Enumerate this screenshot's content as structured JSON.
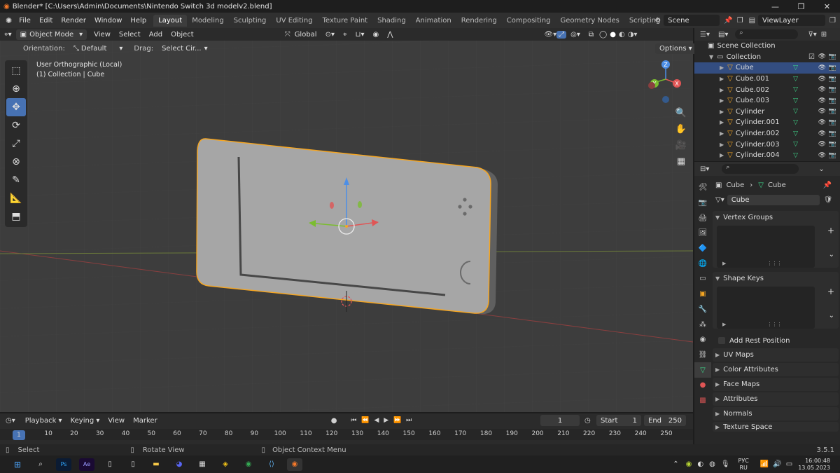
{
  "window": {
    "title": "Blender* [C:\\Users\\Admin\\Documents\\Nintendo Switch 3d modelv2.blend]",
    "controls": [
      "—",
      "❐",
      "✕"
    ]
  },
  "menu": [
    "File",
    "Edit",
    "Render",
    "Window",
    "Help"
  ],
  "workspace_tabs": [
    "Layout",
    "Modeling",
    "Sculpting",
    "UV Editing",
    "Texture Paint",
    "Shading",
    "Animation",
    "Rendering",
    "Compositing",
    "Geometry Nodes",
    "Scripting"
  ],
  "active_workspace": "Layout",
  "scene": {
    "name": "Scene",
    "view_layer": "ViewLayer"
  },
  "viewport_header": {
    "mode": "Object Mode",
    "menus": [
      "View",
      "Select",
      "Add",
      "Object"
    ],
    "transform_orientation": "Global",
    "orientation_label": "Orientation:",
    "orientation_value": "Default",
    "drag_label": "Drag:",
    "drag_value": "Select Cir...",
    "options": "Options"
  },
  "viewport_info": {
    "line1": "User Orthographic (Local)",
    "line2": "(1) Collection | Cube"
  },
  "gizmo": {
    "x": "X",
    "y": "Y",
    "z": "Z"
  },
  "tools": [
    "select-box",
    "cursor",
    "move",
    "rotate",
    "scale",
    "transform",
    "annotate",
    "measure",
    "add-cube"
  ],
  "active_tool": "move",
  "outliner": {
    "scene_collection": "Scene Collection",
    "collection": "Collection",
    "objects": [
      "Cube",
      "Cube.001",
      "Cube.002",
      "Cube.003",
      "Cylinder",
      "Cylinder.001",
      "Cylinder.002",
      "Cylinder.003",
      "Cylinder.004"
    ],
    "selected": "Cube"
  },
  "properties": {
    "breadcrumb_object": "Cube",
    "breadcrumb_data": "Cube",
    "mesh_name": "Cube",
    "panels": {
      "vertex_groups": "Vertex Groups",
      "shape_keys": "Shape Keys",
      "add_rest_position": "Add Rest Position",
      "uv_maps": "UV Maps",
      "color_attributes": "Color Attributes",
      "face_maps": "Face Maps",
      "attributes": "Attributes",
      "normals": "Normals",
      "texture_space": "Texture Space"
    }
  },
  "timeline": {
    "menus": [
      "Playback",
      "Keying",
      "View",
      "Marker"
    ],
    "current_frame": "1",
    "start_label": "Start",
    "start": "1",
    "end_label": "End",
    "end": "250",
    "ruler": [
      "1",
      "10",
      "20",
      "30",
      "40",
      "50",
      "60",
      "70",
      "80",
      "90",
      "100",
      "110",
      "120",
      "130",
      "140",
      "150",
      "160",
      "170",
      "180",
      "190",
      "200",
      "210",
      "220",
      "230",
      "240",
      "250"
    ]
  },
  "statusbar": {
    "select": "Select",
    "rotate_view": "Rotate View",
    "context_menu": "Object Context Menu",
    "version": "3.5.1"
  },
  "taskbar": {
    "lang1": "РУС",
    "lang2": "RU",
    "time": "16:00:48",
    "date": "13.05.2023"
  },
  "colors": {
    "accent": "#4772b3",
    "selection_outline": "#f5a623",
    "viewport": "#3d3d3d"
  }
}
